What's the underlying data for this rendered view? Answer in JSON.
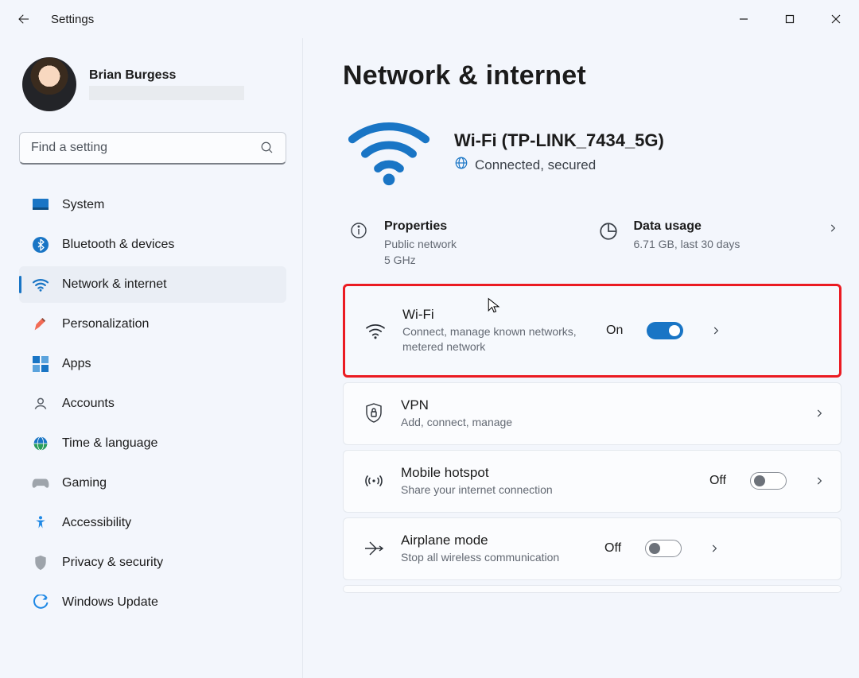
{
  "window": {
    "title": "Settings"
  },
  "profile": {
    "name": "Brian Burgess"
  },
  "search": {
    "placeholder": "Find a setting"
  },
  "sidebar": {
    "items": [
      {
        "id": "system",
        "label": "System"
      },
      {
        "id": "bluetooth",
        "label": "Bluetooth & devices"
      },
      {
        "id": "network",
        "label": "Network & internet",
        "selected": true
      },
      {
        "id": "personalization",
        "label": "Personalization"
      },
      {
        "id": "apps",
        "label": "Apps"
      },
      {
        "id": "accounts",
        "label": "Accounts"
      },
      {
        "id": "time",
        "label": "Time & language"
      },
      {
        "id": "gaming",
        "label": "Gaming"
      },
      {
        "id": "accessibility",
        "label": "Accessibility"
      },
      {
        "id": "privacy",
        "label": "Privacy & security"
      },
      {
        "id": "update",
        "label": "Windows Update"
      }
    ]
  },
  "page": {
    "title": "Network & internet"
  },
  "status": {
    "title": "Wi-Fi (TP-LINK_7434_5G)",
    "subtitle": "Connected, secured"
  },
  "info_cards": {
    "properties": {
      "title": "Properties",
      "sub1": "Public network",
      "sub2": "5 GHz"
    },
    "data_usage": {
      "title": "Data usage",
      "sub": "6.71 GB, last 30 days"
    }
  },
  "cards": {
    "wifi": {
      "title": "Wi-Fi",
      "sub": "Connect, manage known networks, metered network",
      "state_label": "On",
      "state_on": true
    },
    "vpn": {
      "title": "VPN",
      "sub": "Add, connect, manage"
    },
    "hotspot": {
      "title": "Mobile hotspot",
      "sub": "Share your internet connection",
      "state_label": "Off",
      "state_on": false
    },
    "airplane": {
      "title": "Airplane mode",
      "sub": "Stop all wireless communication",
      "state_label": "Off",
      "state_on": false
    }
  }
}
